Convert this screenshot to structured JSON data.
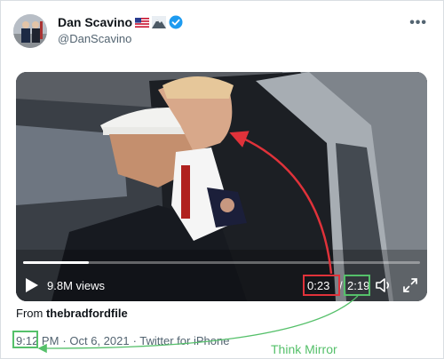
{
  "tweet": {
    "author_name": "Dan Scavino",
    "author_handle": "@DanScavino",
    "from_prefix": "From",
    "source_account": "thebradfordfile",
    "time": "9:12 PM",
    "date": "· Oct 6, 2021",
    "client": "· Twitter for iPhone"
  },
  "video": {
    "views": "9.8M views",
    "current_time": "0:23",
    "separator": "/",
    "total_time": "2:19",
    "progress": 0.165
  },
  "annotation": {
    "label": "Think Mirror",
    "box_color": "#e0323a",
    "arrow_color": "#e0323a",
    "green_color": "#55c06a"
  },
  "icons": {
    "more": "more-icon",
    "verified": "verified-badge-icon",
    "play": "play-icon",
    "volume": "volume-icon",
    "fullscreen": "fullscreen-icon"
  }
}
